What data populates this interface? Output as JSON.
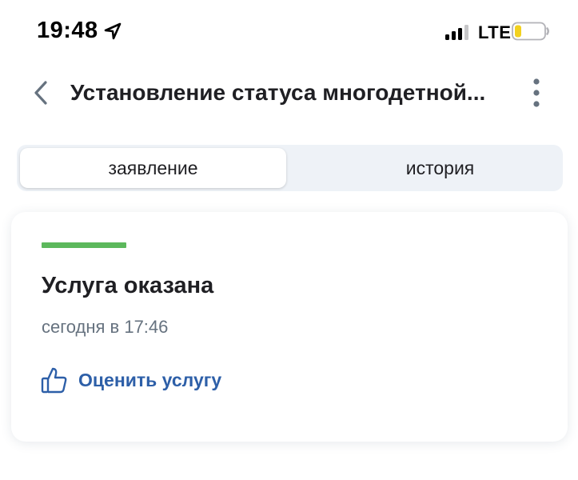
{
  "status_bar": {
    "time": "19:48",
    "network": "LTE",
    "icons": [
      "location-arrow-icon",
      "signal-icon",
      "battery-icon"
    ]
  },
  "header": {
    "title": "Установление статуса многодетной...",
    "icons": [
      "chevron-left-icon",
      "more-vertical-icon"
    ]
  },
  "tabs": [
    {
      "label": "заявление",
      "active": true
    },
    {
      "label": "история",
      "active": false
    }
  ],
  "status_card": {
    "progress_color": "#5cb85c",
    "title": "Услуга оказана",
    "timestamp": "сегодня в 17:46",
    "rate_label": "Оценить услугу",
    "rate_icon": "thumbs-up-icon"
  },
  "colors": {
    "accent": "#2d5fa8",
    "success": "#5cb85c",
    "segment_background": "#eef2f7",
    "secondary_text": "#66727f"
  }
}
